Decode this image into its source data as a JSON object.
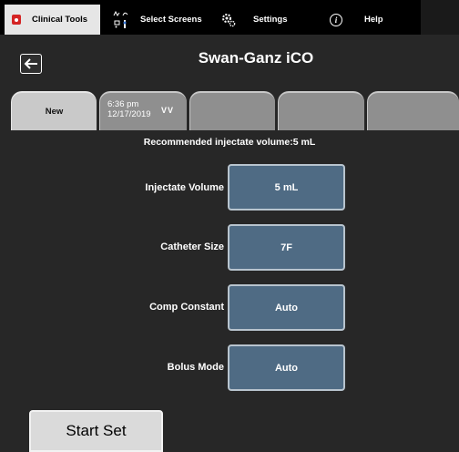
{
  "nav": {
    "tabs": [
      {
        "label": "Clinical Tools",
        "icon": "clinical-tools-icon"
      },
      {
        "label": "Select Screens",
        "icon": "select-screens-icon"
      },
      {
        "label": "Settings",
        "icon": "settings-gear-icon"
      },
      {
        "label": "Help",
        "icon": "info-icon"
      }
    ],
    "active": "Clinical Tools"
  },
  "header": {
    "title": "Swan-Ganz iCO",
    "back_icon": "back-arrow-icon"
  },
  "sessions": {
    "tabs": [
      {
        "label": "New"
      },
      {
        "time": "6:36 pm",
        "date": "12/17/2019",
        "indicator": "VV"
      },
      {
        "label": ""
      },
      {
        "label": ""
      },
      {
        "label": ""
      }
    ]
  },
  "recommendation": "Recommended injectate volume:5 mL",
  "params": [
    {
      "label": "Injectate Volume",
      "value": "5 mL"
    },
    {
      "label": "Catheter Size",
      "value": "7F"
    },
    {
      "label": "Comp Constant",
      "value": "Auto"
    },
    {
      "label": "Bolus Mode",
      "value": "Auto"
    }
  ],
  "actions": {
    "start_set": "Start Set"
  },
  "colors": {
    "background": "#272727",
    "param_button": "#4f6b84",
    "active_tab": "#c9c9c9",
    "inactive_tab": "#8f8f8f"
  }
}
